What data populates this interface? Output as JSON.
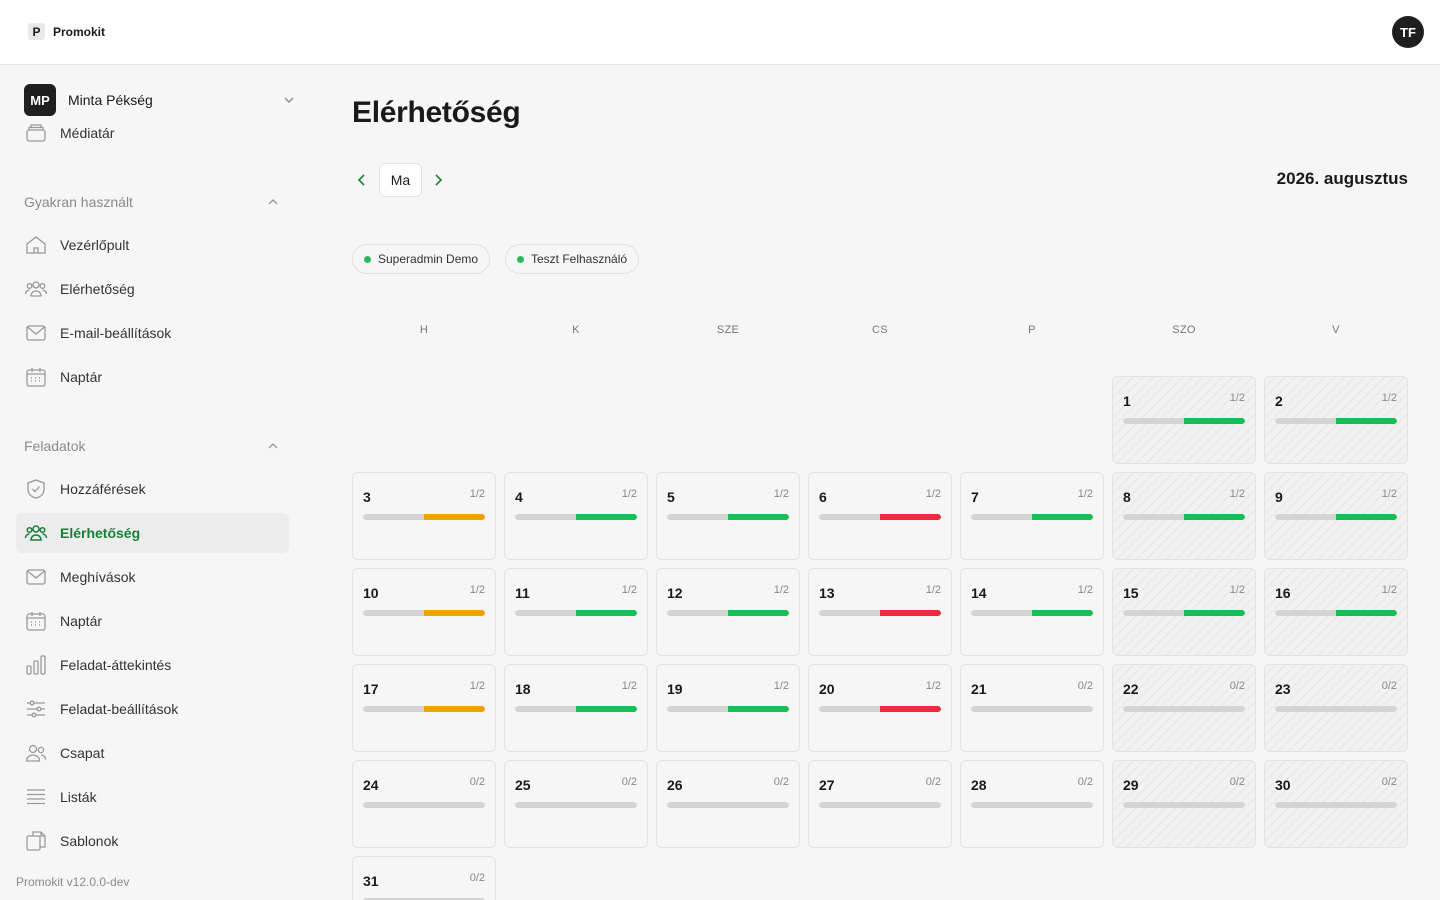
{
  "app": {
    "name": "Promokit",
    "logo_letter": "P",
    "user_initials": "TF",
    "version": "Promokit v12.0.0-dev"
  },
  "org": {
    "initials": "MP",
    "name": "Minta Pékség"
  },
  "sidebar": {
    "top_item": {
      "label": "Médiatár",
      "icon": "archive-icon"
    },
    "frequent": {
      "title": "Gyakran használt",
      "items": [
        {
          "label": "Vezérlőpult",
          "icon": "home-icon"
        },
        {
          "label": "Elérhetőség",
          "icon": "users-icon"
        },
        {
          "label": "E-mail-beállítások",
          "icon": "mail-icon"
        },
        {
          "label": "Naptár",
          "icon": "calendar-icon"
        }
      ]
    },
    "tasks": {
      "title": "Feladatok",
      "items": [
        {
          "label": "Hozzáférések",
          "icon": "shield-check-icon"
        },
        {
          "label": "Elérhetőség",
          "icon": "users-icon",
          "active": true
        },
        {
          "label": "Meghívások",
          "icon": "mail-icon"
        },
        {
          "label": "Naptár",
          "icon": "calendar-icon"
        },
        {
          "label": "Feladat-áttekintés",
          "icon": "bar-chart-icon"
        },
        {
          "label": "Feladat-beállítások",
          "icon": "sliders-icon"
        },
        {
          "label": "Csapat",
          "icon": "team-icon"
        },
        {
          "label": "Listák",
          "icon": "list-icon"
        },
        {
          "label": "Sablonok",
          "icon": "copy-icon"
        }
      ]
    }
  },
  "main": {
    "title": "Elérhetőség",
    "today_label": "Ma",
    "month_label": "2026. augusztus",
    "users": [
      {
        "name": "Superadmin Demo",
        "color": "#2db85b"
      },
      {
        "name": "Teszt Felhasználó",
        "color": "#2db85b"
      }
    ],
    "weekdays": [
      "H",
      "K",
      "SZE",
      "CS",
      "P",
      "SZO",
      "V"
    ]
  },
  "colors": {
    "accent": "#1a7f37",
    "ok": "#12c05a",
    "warn": "#f5a000",
    "bad": "#ea2c3f",
    "empty": "#d4d4d4"
  },
  "calendar": {
    "first_weekday_index": 5,
    "days": [
      {
        "n": "1",
        "count": "1/2",
        "fraction": 0.5,
        "status": "ok"
      },
      {
        "n": "2",
        "count": "1/2",
        "fraction": 0.5,
        "status": "ok"
      },
      {
        "n": "3",
        "count": "1/2",
        "fraction": 0.5,
        "status": "warn"
      },
      {
        "n": "4",
        "count": "1/2",
        "fraction": 0.5,
        "status": "ok"
      },
      {
        "n": "5",
        "count": "1/2",
        "fraction": 0.5,
        "status": "ok"
      },
      {
        "n": "6",
        "count": "1/2",
        "fraction": 0.5,
        "status": "bad"
      },
      {
        "n": "7",
        "count": "1/2",
        "fraction": 0.5,
        "status": "ok"
      },
      {
        "n": "8",
        "count": "1/2",
        "fraction": 0.5,
        "status": "ok"
      },
      {
        "n": "9",
        "count": "1/2",
        "fraction": 0.5,
        "status": "ok"
      },
      {
        "n": "10",
        "count": "1/2",
        "fraction": 0.5,
        "status": "warn"
      },
      {
        "n": "11",
        "count": "1/2",
        "fraction": 0.5,
        "status": "ok"
      },
      {
        "n": "12",
        "count": "1/2",
        "fraction": 0.5,
        "status": "ok"
      },
      {
        "n": "13",
        "count": "1/2",
        "fraction": 0.5,
        "status": "bad"
      },
      {
        "n": "14",
        "count": "1/2",
        "fraction": 0.5,
        "status": "ok"
      },
      {
        "n": "15",
        "count": "1/2",
        "fraction": 0.5,
        "status": "ok"
      },
      {
        "n": "16",
        "count": "1/2",
        "fraction": 0.5,
        "status": "ok"
      },
      {
        "n": "17",
        "count": "1/2",
        "fraction": 0.5,
        "status": "warn"
      },
      {
        "n": "18",
        "count": "1/2",
        "fraction": 0.5,
        "status": "ok"
      },
      {
        "n": "19",
        "count": "1/2",
        "fraction": 0.5,
        "status": "ok"
      },
      {
        "n": "20",
        "count": "1/2",
        "fraction": 0.5,
        "status": "bad"
      },
      {
        "n": "21",
        "count": "0/2",
        "fraction": 0,
        "status": "empty"
      },
      {
        "n": "22",
        "count": "0/2",
        "fraction": 0,
        "status": "empty"
      },
      {
        "n": "23",
        "count": "0/2",
        "fraction": 0,
        "status": "empty"
      },
      {
        "n": "24",
        "count": "0/2",
        "fraction": 0,
        "status": "empty"
      },
      {
        "n": "25",
        "count": "0/2",
        "fraction": 0,
        "status": "empty"
      },
      {
        "n": "26",
        "count": "0/2",
        "fraction": 0,
        "status": "empty"
      },
      {
        "n": "27",
        "count": "0/2",
        "fraction": 0,
        "status": "empty"
      },
      {
        "n": "28",
        "count": "0/2",
        "fraction": 0,
        "status": "empty"
      },
      {
        "n": "29",
        "count": "0/2",
        "fraction": 0,
        "status": "empty"
      },
      {
        "n": "30",
        "count": "0/2",
        "fraction": 0,
        "status": "empty"
      },
      {
        "n": "31",
        "count": "0/2",
        "fraction": 0,
        "status": "empty"
      }
    ]
  }
}
